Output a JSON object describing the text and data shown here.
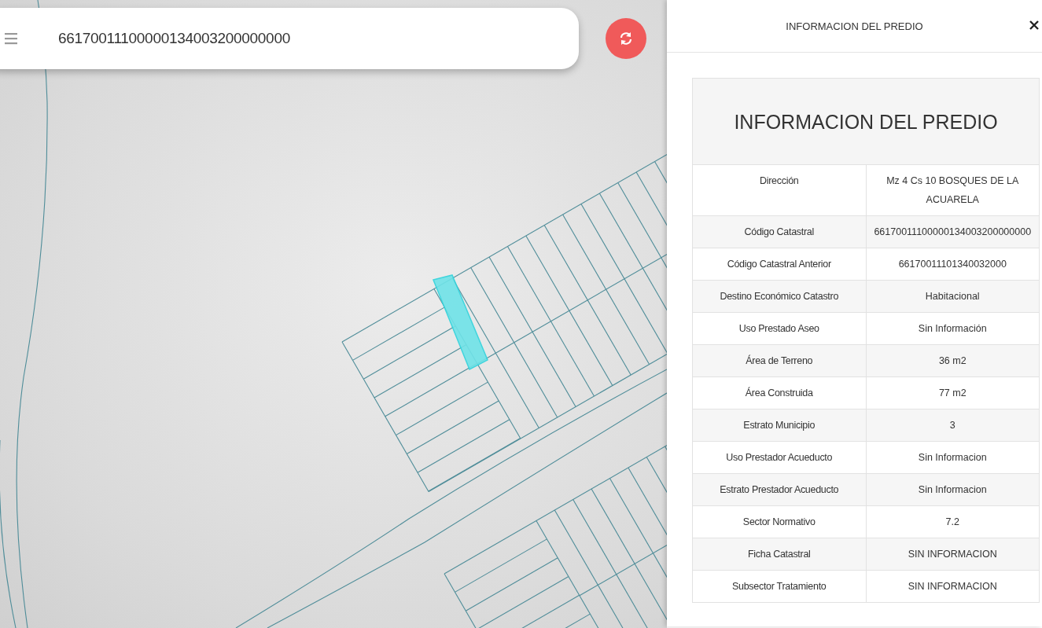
{
  "search": {
    "value": "66170011100000134003200000000"
  },
  "panel": {
    "title": "INFORMACION DEL PREDIO"
  },
  "table": {
    "title": "INFORMACION DEL PREDIO",
    "rows": [
      {
        "label": "Dirección",
        "value": "Mz 4 Cs 10 BOSQUES DE LA ACUARELA"
      },
      {
        "label": "Código Catastral",
        "value": "66170011100000134003200000000"
      },
      {
        "label": "Código Catastral Anterior",
        "value": "66170011101340032000"
      },
      {
        "label": "Destino Económico Catastro",
        "value": "Habitacional"
      },
      {
        "label": "Uso Prestado Aseo",
        "value": "Sin Información"
      },
      {
        "label": "Área de Terreno",
        "value": "36 m2"
      },
      {
        "label": "Área Construida",
        "value": "77 m2"
      },
      {
        "label": "Estrato Municipio",
        "value": "3"
      },
      {
        "label": "Uso Prestador Acueducto",
        "value": "Sin Informacion"
      },
      {
        "label": "Estrato Prestador Acueducto",
        "value": "Sin Informacion"
      },
      {
        "label": "Sector Normativo",
        "value": "7.2"
      },
      {
        "label": "Ficha Catastral",
        "value": "SIN INFORMACION"
      },
      {
        "label": "Subsector Tratamiento",
        "value": "SIN INFORMACION"
      }
    ]
  }
}
